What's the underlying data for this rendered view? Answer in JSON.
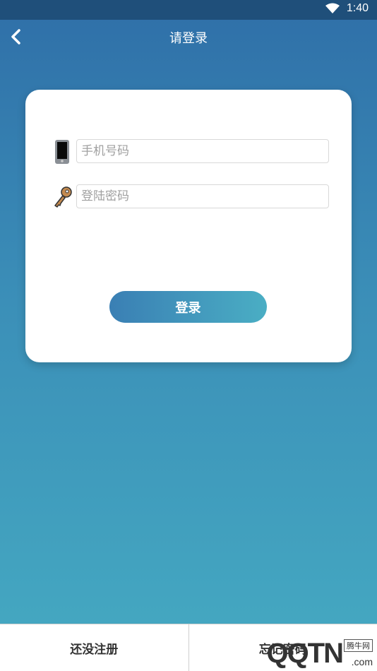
{
  "status_bar": {
    "time": "1:40",
    "wifi_icon": "wifi-icon"
  },
  "header": {
    "title": "请登录",
    "back_icon": "chevron-left-icon"
  },
  "form": {
    "phone": {
      "placeholder": "手机号码",
      "value": "",
      "icon": "phone-icon"
    },
    "password": {
      "placeholder": "登陆密码",
      "value": "",
      "icon": "key-icon"
    },
    "login_label": "登录"
  },
  "bottom": {
    "register_label": "还没注册",
    "forgot_label": "忘记密码"
  },
  "watermark": {
    "logo": "QQTN",
    "sub": "腾牛网",
    "suffix": ".com"
  },
  "colors": {
    "accent_start": "#3a7fb4",
    "accent_end": "#4aaec4",
    "status_bar": "#1f4f7a"
  }
}
